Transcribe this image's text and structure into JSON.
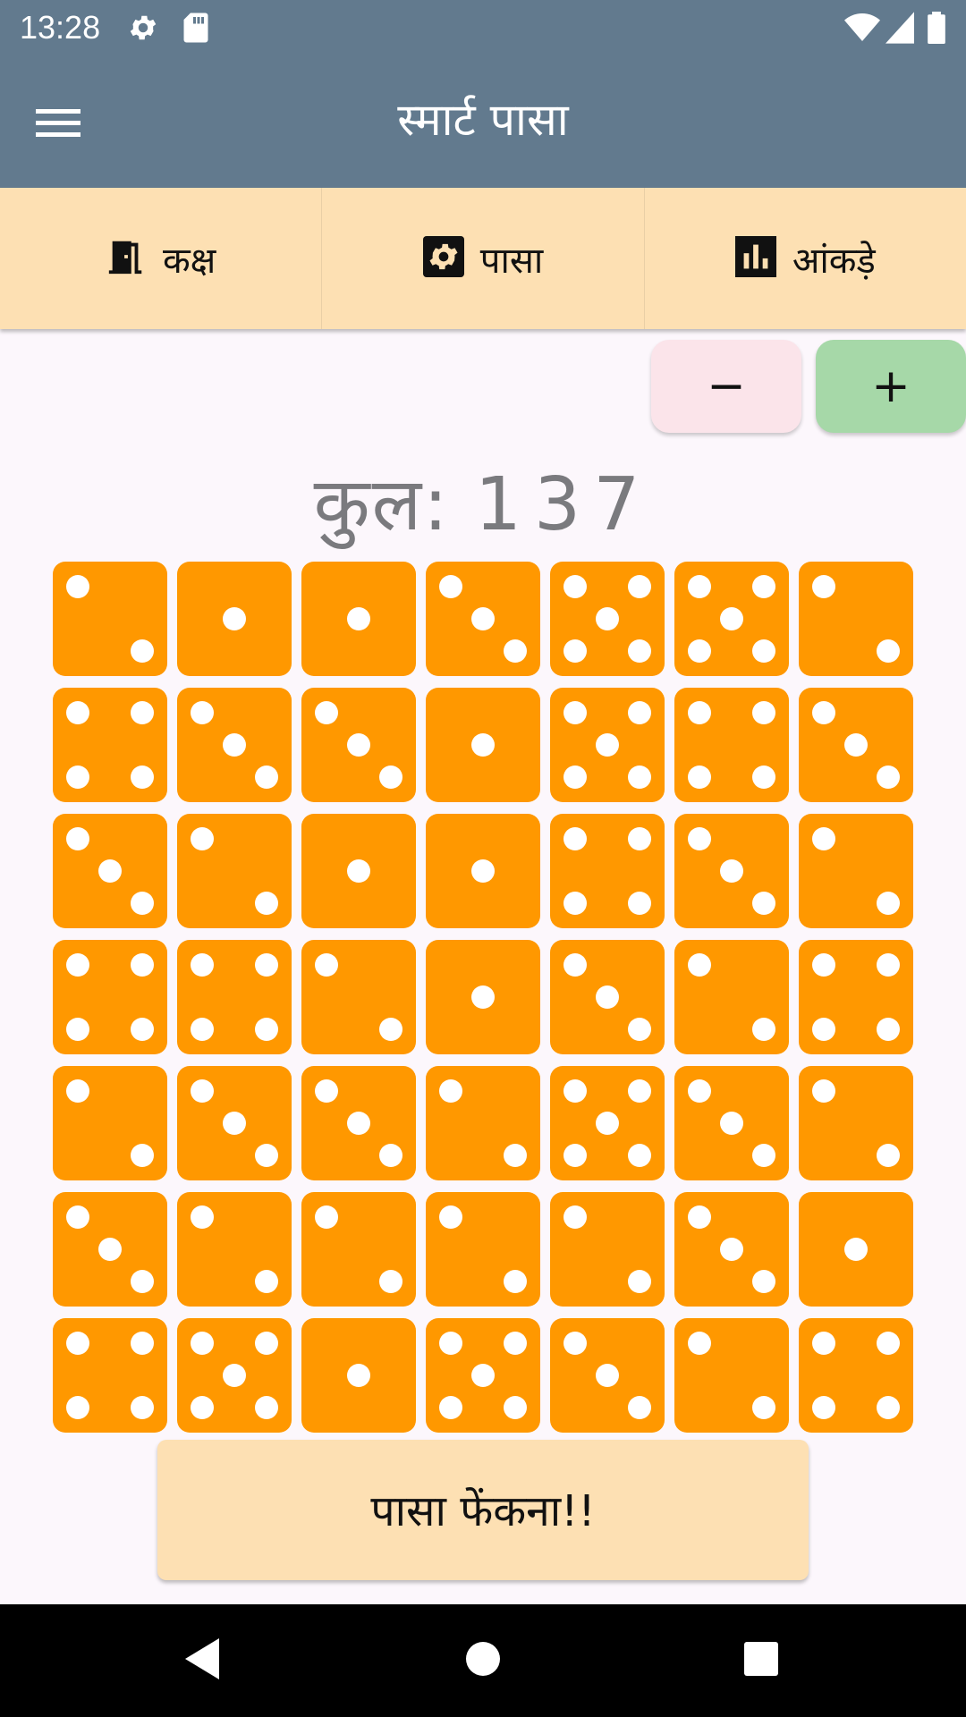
{
  "status": {
    "time": "13:28"
  },
  "appbar": {
    "title": "स्मार्ट पासा",
    "menu_icon": "menu-icon"
  },
  "tabs": [
    {
      "label": "कक्ष",
      "icon": "door-icon"
    },
    {
      "label": "पासा",
      "icon": "dice-icon"
    },
    {
      "label": "आंकड़े",
      "icon": "bar-chart-icon"
    }
  ],
  "stepper": {
    "minus_label": "−",
    "plus_label": "+"
  },
  "total": {
    "label": "कुल:",
    "value": "137"
  },
  "dice": [
    2,
    1,
    1,
    3,
    5,
    5,
    2,
    4,
    3,
    3,
    1,
    5,
    4,
    3,
    3,
    2,
    1,
    1,
    4,
    3,
    2,
    4,
    4,
    2,
    1,
    3,
    2,
    4,
    2,
    3,
    3,
    2,
    5,
    3,
    2,
    3,
    2,
    2,
    2,
    2,
    3,
    1,
    4,
    5,
    1,
    5,
    3,
    2,
    4
  ],
  "colors": {
    "die": "#ff9800",
    "appbar": "#627a8e",
    "tabs": "#fde0b3",
    "plus": "#a6d8a8",
    "minus": "#fbe4ea"
  },
  "roll_button": {
    "label": "पासा फेंकना!!"
  }
}
